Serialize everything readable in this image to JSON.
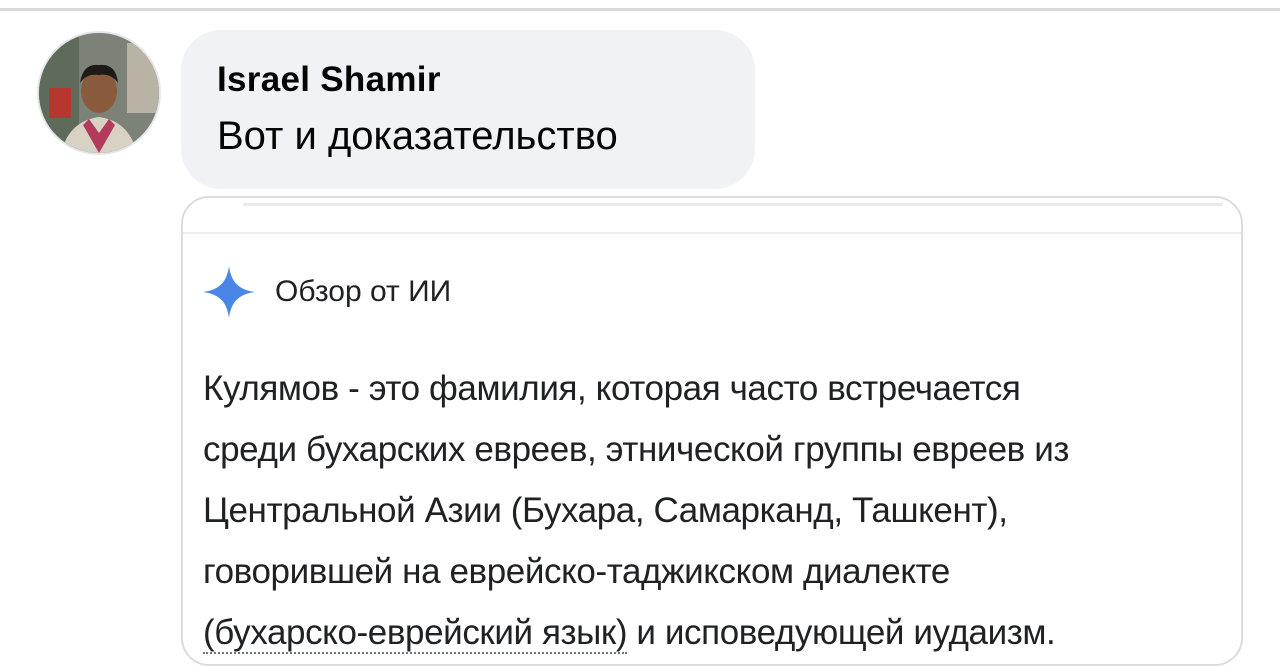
{
  "comment": {
    "author": "Israel Shamir",
    "text": "Вот и доказательство",
    "avatar_icon": "user-avatar-photo"
  },
  "ai_overview": {
    "icon": "gemini-sparkle-icon",
    "icon_color": "#4285f4",
    "label": "Обзор от ИИ",
    "lines": [
      "Кулямов - это фамилия, которая часто встречается",
      "среди бухарских евреев, этнической группы евреев из",
      "Центральной Азии (Бухара, Самарканд, Ташкент),",
      "говорившей на еврейско-таджикском диалекте"
    ],
    "last_line_link": "(бухарско-еврейский язык)",
    "last_line_rest": " и исповедующей иудаизм."
  }
}
